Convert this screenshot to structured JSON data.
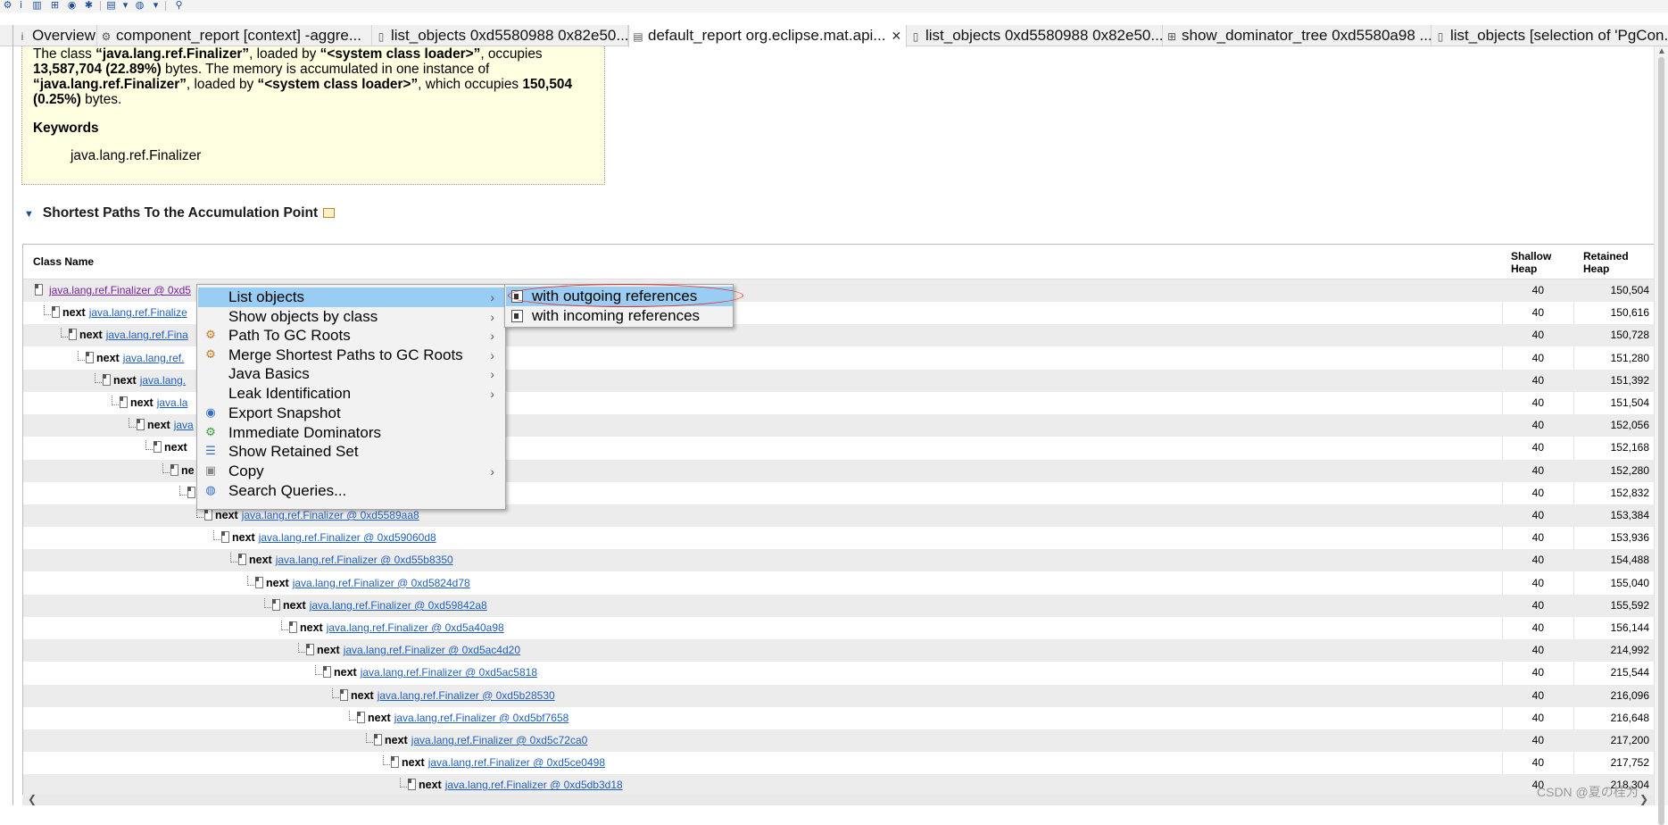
{
  "tabs": [
    {
      "label": "Overview",
      "icon": "info-icon"
    },
    {
      "label": "component_report [context] -aggre...",
      "icon": "report-icon"
    },
    {
      "label": "list_objects 0xd5580988 0x82e50...",
      "icon": "list-icon"
    },
    {
      "label": "default_report org.eclipse.mat.api...",
      "icon": "report-icon",
      "active": true
    },
    {
      "label": "list_objects 0xd5580988 0x82e50...",
      "icon": "list-icon"
    },
    {
      "label": "show_dominator_tree 0xd5580a98  ...",
      "icon": "dominator-icon"
    },
    {
      "label": "list_objects [selection of 'PgCon...",
      "icon": "list-icon"
    }
  ],
  "description": {
    "p1": "The class ",
    "class1": "“java.lang.ref.Finalizer”",
    "p2": ", loaded by ",
    "loader1": "“<system class loader>”",
    "p3": ", occupies ",
    "occupies": "13,587,704 (22.89%)",
    "p4": " bytes. The memory is accumulated in one instance of ",
    "class2": "“java.lang.ref.Finalizer”",
    "p5": ", loaded by ",
    "loader2": "“<system class loader>”",
    "p6": ", which occupies ",
    "which_occupies": "150,504 (0.25%)",
    "p7": " bytes.",
    "keywords_heading": "Keywords",
    "keyword": "java.lang.ref.Finalizer"
  },
  "section": {
    "title": "Shortest Paths To the Accumulation Point"
  },
  "table": {
    "headers": {
      "class_name": "Class Name",
      "shallow": "Shallow\nHeap",
      "retained": "Retained\nHeap"
    },
    "rows": [
      {
        "prefix": "",
        "link": "java.lang.ref.Finalizer @ 0xd5",
        "shallow": "40",
        "retained": "150,504"
      },
      {
        "prefix": "next",
        "link": "java.lang.ref.Finalize",
        "shallow": "40",
        "retained": "150,616"
      },
      {
        "prefix": "next",
        "link": "java.lang.ref.Fina",
        "shallow": "40",
        "retained": "150,728"
      },
      {
        "prefix": "next",
        "link": "java.lang.ref.",
        "shallow": "40",
        "retained": "151,280"
      },
      {
        "prefix": "next",
        "link": "java.lang.",
        "shallow": "40",
        "retained": "151,392"
      },
      {
        "prefix": "next",
        "link": "java.la",
        "shallow": "40",
        "retained": "151,504"
      },
      {
        "prefix": "next",
        "link": "java",
        "shallow": "40",
        "retained": "152,056"
      },
      {
        "prefix": "next",
        "link": "",
        "shallow": "40",
        "retained": "152,168"
      },
      {
        "prefix": "ne",
        "link": "",
        "shallow": "40",
        "retained": "152,280"
      },
      {
        "prefix": "",
        "link": "",
        "shallow": "40",
        "retained": "152,832"
      },
      {
        "prefix": "next",
        "link": "java.lang.ref.Finalizer @ 0xd5589aa8",
        "shallow": "40",
        "retained": "153,384"
      },
      {
        "prefix": "next",
        "link": "java.lang.ref.Finalizer @ 0xd59060d8",
        "shallow": "40",
        "retained": "153,936"
      },
      {
        "prefix": "next",
        "link": "java.lang.ref.Finalizer @ 0xd55b8350",
        "shallow": "40",
        "retained": "154,488"
      },
      {
        "prefix": "next",
        "link": "java.lang.ref.Finalizer @ 0xd5824d78",
        "shallow": "40",
        "retained": "155,040"
      },
      {
        "prefix": "next",
        "link": "java.lang.ref.Finalizer @ 0xd59842a8",
        "shallow": "40",
        "retained": "155,592"
      },
      {
        "prefix": "next",
        "link": "java.lang.ref.Finalizer @ 0xd5a40a98",
        "shallow": "40",
        "retained": "156,144"
      },
      {
        "prefix": "next",
        "link": "java.lang.ref.Finalizer @ 0xd5ac4d20",
        "shallow": "40",
        "retained": "214,992"
      },
      {
        "prefix": "next",
        "link": "java.lang.ref.Finalizer @ 0xd5ac5818",
        "shallow": "40",
        "retained": "215,544"
      },
      {
        "prefix": "next",
        "link": "java.lang.ref.Finalizer @ 0xd5b28530",
        "shallow": "40",
        "retained": "216,096"
      },
      {
        "prefix": "next",
        "link": "java.lang.ref.Finalizer @ 0xd5bf7658",
        "shallow": "40",
        "retained": "216,648"
      },
      {
        "prefix": "next",
        "link": "java.lang.ref.Finalizer @ 0xd5c72ca0",
        "shallow": "40",
        "retained": "217,200"
      },
      {
        "prefix": "next",
        "link": "java.lang.ref.Finalizer @ 0xd5ce0498",
        "shallow": "40",
        "retained": "217,752"
      },
      {
        "prefix": "next",
        "link": "java.lang.ref.Finalizer @ 0xd5db3d18",
        "shallow": "40",
        "retained": "218,304"
      }
    ]
  },
  "context_menu": {
    "items": [
      {
        "label": "List objects",
        "icon": "",
        "submenu": true,
        "highlighted": true
      },
      {
        "label": "Show objects by class",
        "icon": "",
        "submenu": true
      },
      {
        "label": "Path To GC Roots",
        "icon": "path-gc-roots-icon",
        "submenu": true
      },
      {
        "label": "Merge Shortest Paths to GC Roots",
        "icon": "merge-paths-icon",
        "submenu": true
      },
      {
        "label": "Java Basics",
        "icon": "",
        "submenu": true
      },
      {
        "label": "Leak Identification",
        "icon": "",
        "submenu": true
      },
      {
        "label": "Export Snapshot",
        "icon": "export-snapshot-icon",
        "submenu": false
      },
      {
        "label": "Immediate Dominators",
        "icon": "dominators-icon",
        "submenu": false
      },
      {
        "label": "Show Retained Set",
        "icon": "retained-set-icon",
        "submenu": false
      },
      {
        "label": "Copy",
        "icon": "copy-icon",
        "submenu": true
      },
      {
        "label": "Search Queries...",
        "icon": "search-queries-icon",
        "submenu": false
      }
    ]
  },
  "submenu": {
    "items": [
      {
        "label": "with outgoing references",
        "highlighted": true
      },
      {
        "label": "with incoming references"
      }
    ]
  },
  "watermark": "CSDN @夏の桂为",
  "colors": {
    "highlight": "#99cdf3",
    "description_bg": "#ffffe1",
    "link": "#1f5fbf",
    "annotation": "#e03030"
  }
}
